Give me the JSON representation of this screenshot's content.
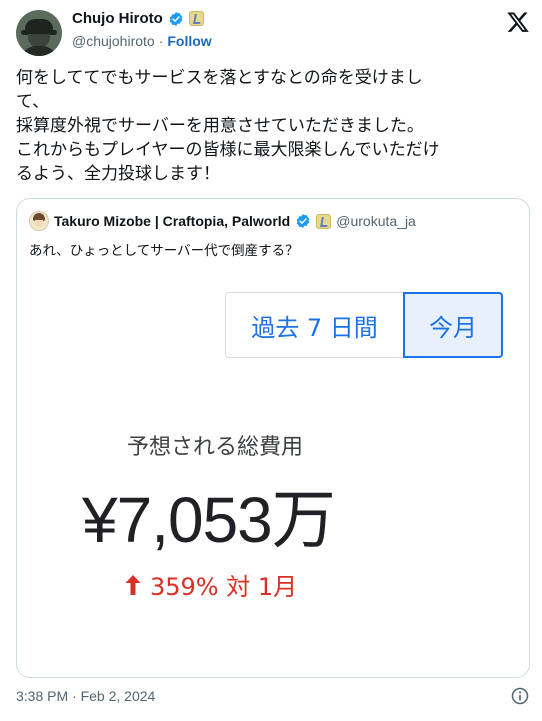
{
  "author": {
    "display_name": "Chujo Hiroto",
    "handle": "@chujohiroto",
    "separator": "·",
    "follow_label": "Follow"
  },
  "tweet": {
    "text": "何をしててでもサービスを落とすなとの命を受けまし\nて、\n採算度外視でサーバーを用意させていただきました。\nこれからもプレイヤーの皆様に最大限楽しんでいただけ\nるよう、全力投球します！"
  },
  "quote": {
    "display_name": "Takuro Mizobe | Craftopia, Palworld",
    "handle": "@urokuta_ja",
    "text": "あれ、ひょっとしてサーバー代で倒産する？",
    "image": {
      "tab_left": "過去 7 日間",
      "tab_right": "今月",
      "cost_label": "予想される総費用",
      "cost_value": "¥7,053万",
      "change_text": "359% 対 1月"
    }
  },
  "footer": {
    "timestamp": "3:38 PM · Feb 2, 2024"
  },
  "colors": {
    "verified_blue": "#1d9bf0",
    "follow_blue": "#1d6ab9",
    "tab_blue": "#1a73e8",
    "down_red": "#d93025"
  },
  "icons": [
    "verified-icon",
    "affiliate-badge-icon",
    "x-logo-icon",
    "info-icon",
    "arrow-up-icon"
  ]
}
